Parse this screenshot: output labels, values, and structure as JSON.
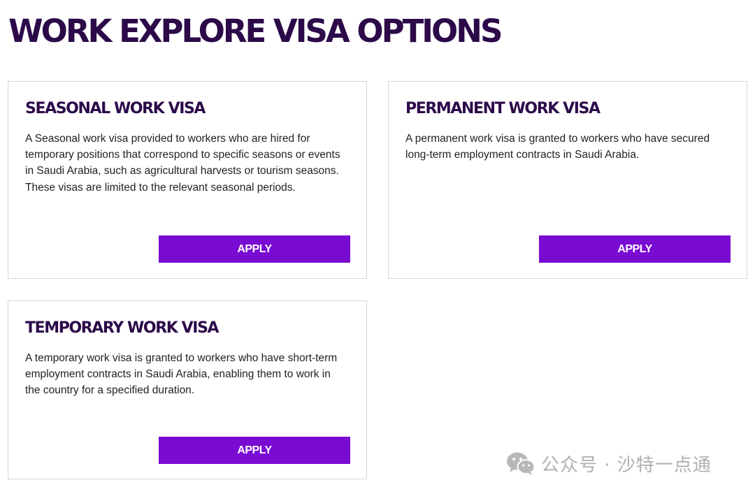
{
  "page": {
    "title": "WORK EXPLORE VISA OPTIONS"
  },
  "cards": [
    {
      "title": "SEASONAL WORK VISA",
      "description": "A Seasonal work visa provided to workers who are hired for temporary positions that correspond to specific seasons or events in Saudi Arabia, such as agricultural harvests or tourism seasons. These visas are limited to the relevant seasonal periods.",
      "button_label": "APPLY"
    },
    {
      "title": "PERMANENT WORK VISA",
      "description": "A permanent work visa is granted to workers who have secured long-term employment contracts in Saudi Arabia.",
      "button_label": "APPLY"
    },
    {
      "title": "TEMPORARY WORK VISA",
      "description": "A temporary work visa is granted to workers who have short-term employment contracts in Saudi Arabia, enabling them to work in the country for a specified duration.",
      "button_label": "APPLY"
    }
  ],
  "watermark": {
    "icon": "wechat-icon",
    "text": "公众号 · 沙特一点通"
  },
  "colors": {
    "heading": "#2c0a49",
    "button_bg": "#7a0bd2",
    "button_text": "#ffffff",
    "card_border": "#d6d6d6",
    "body_text": "#222222"
  }
}
